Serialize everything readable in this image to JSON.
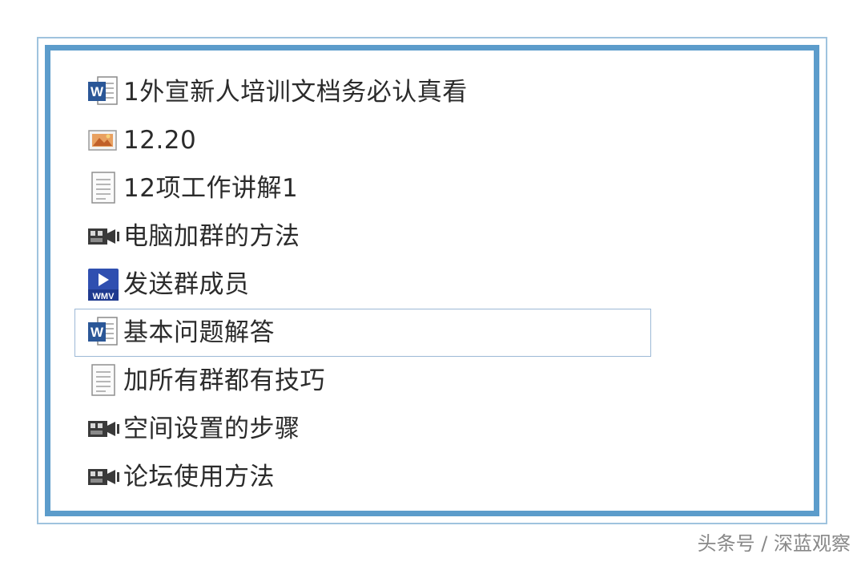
{
  "files": [
    {
      "name": "1外宣新人培训文档务必认真看",
      "icon": "word-doc-icon"
    },
    {
      "name": "12.20",
      "icon": "image-file-icon"
    },
    {
      "name": "12项工作讲解1",
      "icon": "text-file-icon"
    },
    {
      "name": "电脑加群的方法",
      "icon": "video-camera-icon"
    },
    {
      "name": "发送群成员",
      "icon": "wmv-file-icon"
    },
    {
      "name": "基本问题解答",
      "icon": "word-doc-icon",
      "selected": true
    },
    {
      "name": "加所有群都有技巧",
      "icon": "text-file-icon"
    },
    {
      "name": "空间设置的步骤",
      "icon": "video-camera-icon"
    },
    {
      "name": "论坛使用方法",
      "icon": "video-camera-icon"
    }
  ],
  "watermark": "头条号 / 深蓝观察",
  "colors": {
    "frame_outer": "#9fc3de",
    "frame_inner": "#5c9ccb",
    "selection_border": "#9db9d6",
    "word_blue": "#2b5797"
  }
}
